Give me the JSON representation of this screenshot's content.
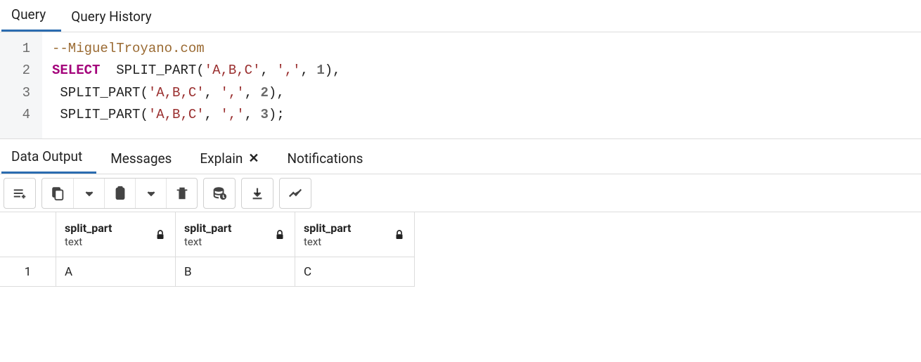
{
  "top_tabs": {
    "query": "Query",
    "history": "Query History"
  },
  "editor": {
    "lines": [
      "1",
      "2",
      "3",
      "4"
    ],
    "l1_comment": "--MiguelTroyano.com",
    "l2_kw": "SELECT",
    "func": "SPLIT_PART",
    "str_arg1": "'A,B,C'",
    "str_arg2": "','",
    "num_1": "1",
    "num_2": "2",
    "num_3": "3"
  },
  "out_tabs": {
    "data": "Data Output",
    "messages": "Messages",
    "explain": "Explain",
    "notifications": "Notifications"
  },
  "columns": [
    {
      "name": "split_part",
      "type": "text"
    },
    {
      "name": "split_part",
      "type": "text"
    },
    {
      "name": "split_part",
      "type": "text"
    }
  ],
  "rows": [
    {
      "n": "1",
      "c0": "A",
      "c1": "B",
      "c2": "C"
    }
  ]
}
